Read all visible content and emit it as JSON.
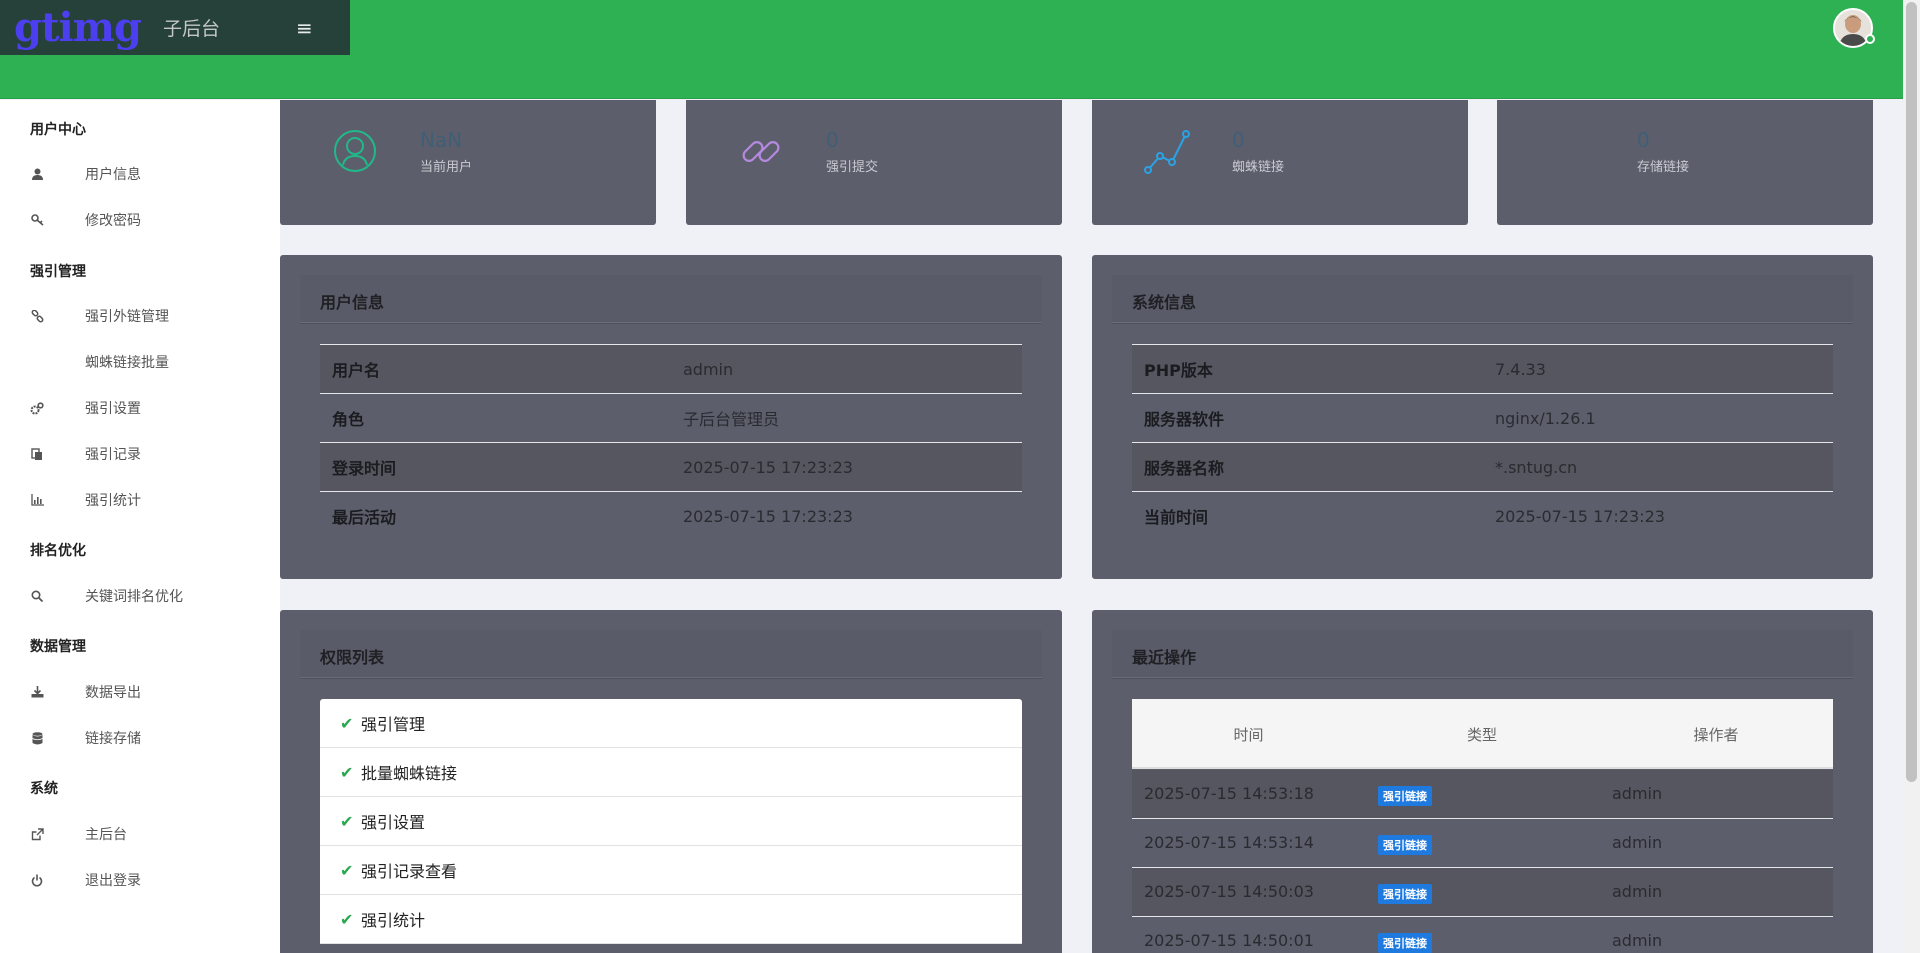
{
  "header": {
    "logo": "gtimg",
    "subtitle": "子后台",
    "menu_icon": "hamburger-icon",
    "colors": {
      "bar": "#2db152",
      "brand_bg": "#26403a",
      "logo": "#4c3ff0"
    }
  },
  "sidebar": {
    "groups": [
      {
        "title": "用户中心",
        "items": [
          {
            "label": "用户信息",
            "icon": "user-icon"
          },
          {
            "label": "修改密码",
            "icon": "key-icon"
          }
        ]
      },
      {
        "title": "强引管理",
        "items": [
          {
            "label": "强引外链管理",
            "icon": "link-icon"
          },
          {
            "label": "蜘蛛链接批量",
            "icon": ""
          },
          {
            "label": "强引设置",
            "icon": "gears-icon"
          },
          {
            "label": "强引记录",
            "icon": "copy-icon"
          },
          {
            "label": "强引统计",
            "icon": "bar-chart-icon"
          }
        ]
      },
      {
        "title": "排名优化",
        "items": [
          {
            "label": "关键词排名优化",
            "icon": "search-icon"
          }
        ]
      },
      {
        "title": "数据管理",
        "items": [
          {
            "label": "数据导出",
            "icon": "download-icon"
          },
          {
            "label": "链接存储",
            "icon": "database-icon"
          }
        ]
      },
      {
        "title": "系统",
        "items": [
          {
            "label": "主后台",
            "icon": "external-link-icon"
          },
          {
            "label": "退出登录",
            "icon": "power-icon"
          }
        ]
      }
    ]
  },
  "stats": [
    {
      "value": "NaN",
      "label": "当前用户",
      "icon": "user-circle-icon",
      "color": "#1fb98a"
    },
    {
      "value": "0",
      "label": "强引提交",
      "icon": "chain-link-icon",
      "color": "#b689e0"
    },
    {
      "value": "0",
      "label": "蜘蛛链接",
      "icon": "trend-line-icon",
      "color": "#2aa3e6"
    },
    {
      "value": "0",
      "label": "存储链接",
      "icon": "",
      "color": ""
    }
  ],
  "user_info": {
    "title": "用户信息",
    "rows": [
      {
        "key": "用户名",
        "value": "admin"
      },
      {
        "key": "角色",
        "value": "子后台管理员"
      },
      {
        "key": "登录时间",
        "value": "2025-07-15 17:23:23"
      },
      {
        "key": "最后活动",
        "value": "2025-07-15 17:23:23"
      }
    ]
  },
  "system_info": {
    "title": "系统信息",
    "rows": [
      {
        "key": "PHP版本",
        "value": "7.4.33"
      },
      {
        "key": "服务器软件",
        "value": "nginx/1.26.1"
      },
      {
        "key": "服务器名称",
        "value": "*.sntug.cn"
      },
      {
        "key": "当前时间",
        "value": "2025-07-15 17:23:23"
      }
    ]
  },
  "permissions": {
    "title": "权限列表",
    "check_icon": "checkmark-icon",
    "items": [
      "强引管理",
      "批量蜘蛛链接",
      "强引设置",
      "强引记录查看",
      "强引统计"
    ]
  },
  "recent_ops": {
    "title": "最近操作",
    "columns": [
      "时间",
      "类型",
      "操作者"
    ],
    "rows": [
      {
        "time": "2025-07-15 14:53:18",
        "type": "强引链接",
        "user": "admin"
      },
      {
        "time": "2025-07-15 14:53:14",
        "type": "强引链接",
        "user": "admin"
      },
      {
        "time": "2025-07-15 14:50:03",
        "type": "强引链接",
        "user": "admin"
      },
      {
        "time": "2025-07-15 14:50:01",
        "type": "强引链接",
        "user": "admin"
      }
    ]
  }
}
